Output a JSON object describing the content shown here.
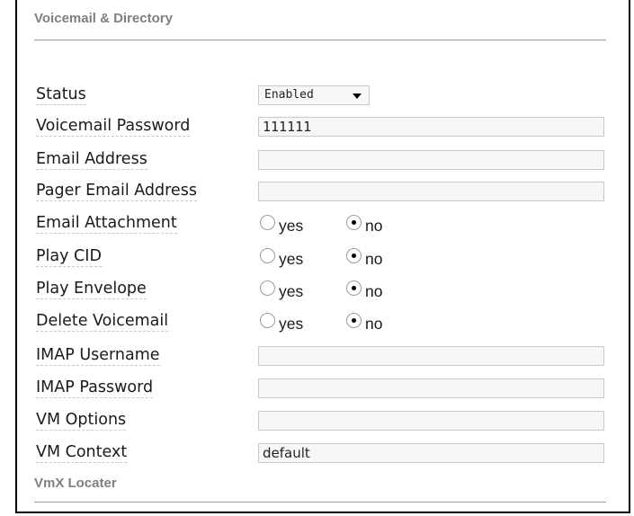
{
  "section": {
    "title": "Voicemail & Directory",
    "next_title": "VmX Locater"
  },
  "status": {
    "label": "Status",
    "value": "Enabled"
  },
  "voicemail_password": {
    "label": "Voicemail Password",
    "value": "111111"
  },
  "email_address": {
    "label": "Email Address",
    "value": ""
  },
  "pager_email_address": {
    "label": "Pager Email Address",
    "value": ""
  },
  "email_attachment": {
    "label": "Email Attachment",
    "yes_label": "yes",
    "no_label": "no",
    "selected": "no"
  },
  "play_cid": {
    "label": "Play CID",
    "yes_label": "yes",
    "no_label": "no",
    "selected": "no"
  },
  "play_envelope": {
    "label": "Play Envelope",
    "yes_label": "yes",
    "no_label": "no",
    "selected": "no"
  },
  "delete_voicemail": {
    "label": "Delete Voicemail",
    "yes_label": "yes",
    "no_label": "no",
    "selected": "no"
  },
  "imap_username": {
    "label": "IMAP Username",
    "value": ""
  },
  "imap_password": {
    "label": "IMAP Password",
    "value": ""
  },
  "vm_options": {
    "label": "VM Options",
    "value": ""
  },
  "vm_context": {
    "label": "VM Context",
    "value": "default"
  }
}
